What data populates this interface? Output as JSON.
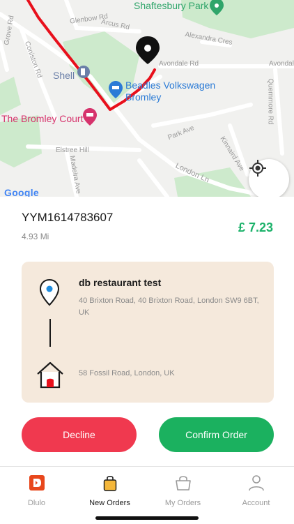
{
  "map": {
    "labels": {
      "shaftesbury_park": "Shaftesbury Park",
      "glenbow_rd": "Glenbow Rd",
      "arcus_rd": "Arcus Rd",
      "alexandra_cres": "Alexandra Cres",
      "avondale_rd_1": "Avondale Rd",
      "avondale_rd_2": "Avondale",
      "coniston_rd": "Coniston Rd",
      "grove_rd": "Grove Rd",
      "shell": "Shell",
      "beadles_line1": "Beadles Volkswagen",
      "beadles_line2": "Bromley",
      "bromley_court": "The Bromley Court",
      "quernmore_rd": "Quernmore Rd",
      "park_ave": "Park Ave",
      "elstree_hill": "Elstree Hill",
      "kinnaird_ave": "Kinnaird Ave",
      "madeira_ave": "Madeira Ave",
      "london_ln": "London Ln",
      "google": "Google",
      "icons": [
        "location-pin-icon",
        "park-marker-icon",
        "fuel-station-icon",
        "car-dealer-icon",
        "hotel-icon",
        "my-location-icon"
      ]
    }
  },
  "order": {
    "id": "YYM1614783607",
    "distance": "4.93 Mi",
    "price": "£ 7.23"
  },
  "pickup": {
    "name": "db restaurant test",
    "address": "40 Brixton Road, 40 Brixton Road, London SW9 6BT, UK"
  },
  "dropoff": {
    "address": "58 Fossil Road, London, UK"
  },
  "actions": {
    "decline": "Decline",
    "confirm": "Confirm Order"
  },
  "tabs": [
    {
      "label": "Dlulo",
      "icon": "dlulo-logo-icon"
    },
    {
      "label": "New Orders",
      "icon": "shopping-bag-icon"
    },
    {
      "label": "My Orders",
      "icon": "basket-icon"
    },
    {
      "label": "Account",
      "icon": "user-icon"
    }
  ],
  "colors": {
    "price": "#1bb26a",
    "decline": "#f0394f",
    "confirm": "#1bb15f",
    "route": "#e8101c",
    "card": "#f5e9dc"
  }
}
